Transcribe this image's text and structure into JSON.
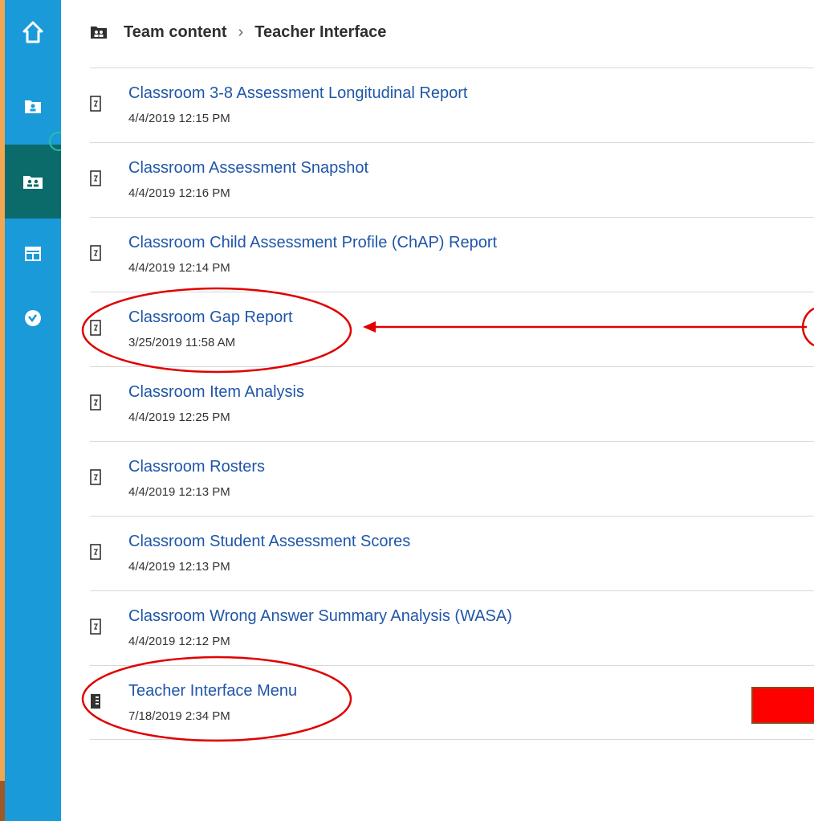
{
  "breadcrumb": {
    "icon": "team-folder-icon",
    "root": "Team content",
    "separator": "›",
    "current": "Teacher Interface"
  },
  "sidebar": {
    "items": [
      {
        "icon": "home-icon",
        "active": false
      },
      {
        "icon": "my-content-folder-icon",
        "active": false
      },
      {
        "icon": "team-content-folder-icon",
        "active": true
      },
      {
        "icon": "dashboard-icon",
        "active": false
      },
      {
        "icon": "check-circle-icon",
        "active": false
      }
    ]
  },
  "reports": [
    {
      "title": "Classroom 3-8 Assessment Longitudinal Report",
      "date": "4/4/2019 12:15 PM",
      "icon": "report-icon"
    },
    {
      "title": "Classroom Assessment Snapshot",
      "date": "4/4/2019 12:16 PM",
      "icon": "report-icon"
    },
    {
      "title": "Classroom Child Assessment Profile (ChAP) Report",
      "date": "4/4/2019 12:14 PM",
      "icon": "report-icon"
    },
    {
      "title": "Classroom Gap Report",
      "date": "3/25/2019 11:58 AM",
      "icon": "report-icon"
    },
    {
      "title": "Classroom Item Analysis",
      "date": "4/4/2019 12:25 PM",
      "icon": "report-icon"
    },
    {
      "title": "Classroom Rosters",
      "date": "4/4/2019 12:13 PM",
      "icon": "report-icon"
    },
    {
      "title": "Classroom Student Assessment Scores",
      "date": "4/4/2019 12:13 PM",
      "icon": "report-icon"
    },
    {
      "title": "Classroom Wrong Answer Summary Analysis (WASA)",
      "date": "4/4/2019 12:12 PM",
      "icon": "report-icon"
    },
    {
      "title": "Teacher Interface Menu",
      "date": "7/18/2019 2:34 PM",
      "icon": "dashboard-report-icon"
    }
  ],
  "colors": {
    "sidebar": "#1a9ad9",
    "sidebar_active": "#0b6a6a",
    "link": "#1f56a8",
    "annotation": "#e00000"
  }
}
